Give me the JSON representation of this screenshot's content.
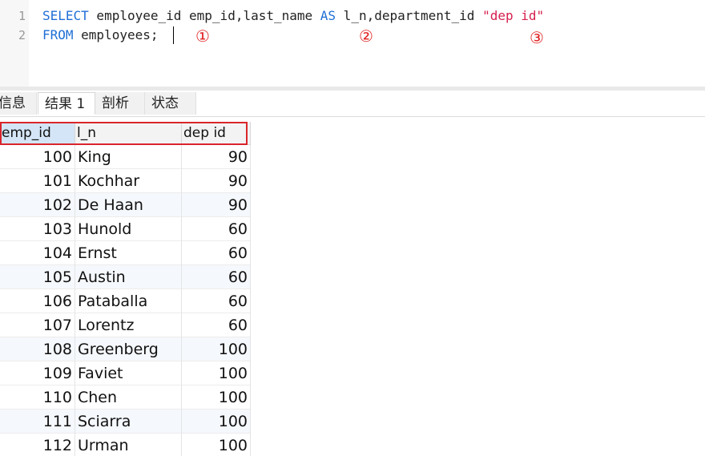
{
  "editor": {
    "line_numbers": [
      "1",
      "2"
    ],
    "line1": {
      "kw_select": "SELECT",
      "text_a": " employee_id emp_id,last_name ",
      "kw_as": "AS",
      "text_b": " l_n,department_id ",
      "str_dep": "\"dep id\""
    },
    "line2": {
      "kw_from": "FROM",
      "text_a": " employees;"
    },
    "markers": [
      "①",
      "②",
      "③"
    ],
    "colors": {
      "keyword": "#1f6fd6",
      "string": "#d6204e",
      "marker": "#e02020"
    }
  },
  "tabs": [
    {
      "label": "信息"
    },
    {
      "label": "结果 1"
    },
    {
      "label": "剖析"
    },
    {
      "label": "状态"
    }
  ],
  "grid": {
    "columns": [
      "emp_id",
      "l_n",
      "dep id"
    ],
    "highlight_color": "#d9262c",
    "rows": [
      [
        "100",
        "King",
        "90"
      ],
      [
        "101",
        "Kochhar",
        "90"
      ],
      [
        "102",
        "De Haan",
        "90"
      ],
      [
        "103",
        "Hunold",
        "60"
      ],
      [
        "104",
        "Ernst",
        "60"
      ],
      [
        "105",
        "Austin",
        "60"
      ],
      [
        "106",
        "Pataballa",
        "60"
      ],
      [
        "107",
        "Lorentz",
        "60"
      ],
      [
        "108",
        "Greenberg",
        "100"
      ],
      [
        "109",
        "Faviet",
        "100"
      ],
      [
        "110",
        "Chen",
        "100"
      ],
      [
        "111",
        "Sciarra",
        "100"
      ],
      [
        "112",
        "Urman",
        "100"
      ]
    ]
  }
}
